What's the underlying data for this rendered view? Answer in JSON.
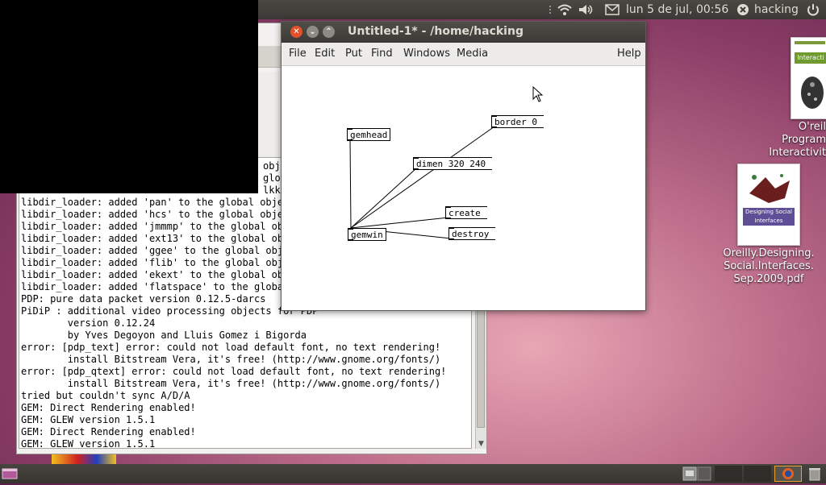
{
  "top_panel": {
    "clock": "lun  5 de jul, 00:56",
    "user": "hacking"
  },
  "patch_window": {
    "title": "Untitled-1* - /home/hacking",
    "menu": [
      "File",
      "Edit",
      "Put",
      "Find",
      "Windows",
      "Media",
      "Help"
    ],
    "objects": {
      "gemhead": "gemhead",
      "border": "border 0",
      "dimen": "dimen 320 240",
      "create": "create",
      "destroy": "destroy",
      "gemwin": "gemwin"
    }
  },
  "console": {
    "lines": [
      "libdir_loader: added 'pan' to the global objec",
      "libdir_loader: added 'hcs' to the global objec",
      "libdir_loader: added 'jmmmp' to the global obj",
      "libdir_loader: added 'ext13' to the global obj",
      "libdir_loader: added 'ggee' to the global obje",
      "libdir_loader: added 'flib' to the global obje",
      "libdir_loader: added 'ekext' to the global obj",
      "libdir_loader: added 'flatspace' to the global",
      "PDP: pure data packet version 0.12.5-darcs",
      "PiDiP : additional video processing objects for PDP",
      "        version 0.12.24",
      "        by Yves Degoyon and Lluis Gomez i Bigorda",
      "error: [pdp_text] error: could not load default font, no text rendering!",
      "        install Bitstream Vera, it's free! (http://www.gnome.org/fonts/)",
      "error: [pdp_qtext] error: could not load default font, no text rendering!",
      "        install Bitstream Vera, it's free! (http://www.gnome.org/fonts/)",
      "tried but couldn't sync A/D/A",
      "GEM: Direct Rendering enabled!",
      "GEM: GLEW version 1.5.1",
      "GEM: Direct Rendering enabled!",
      "GEM: GLEW version 1.5.1"
    ],
    "partial_lines": [
      "obje",
      "glo",
      "lkki"
    ]
  },
  "desktop_icons": {
    "book1_label_lines": [
      "O'reil",
      "Program",
      "Interactivit"
    ],
    "book1_cover_title": "Interacti",
    "book2_label_lines": [
      "Oreilly.Designing.",
      "Social.Interfaces.",
      "Sep.2009.pdf"
    ],
    "book2_cover_title": "Designing Social Interfaces"
  },
  "colors": {
    "panel_bg": "#3c3b37",
    "close_button": "#e0522a",
    "desktop_accent": "#c2738e"
  }
}
